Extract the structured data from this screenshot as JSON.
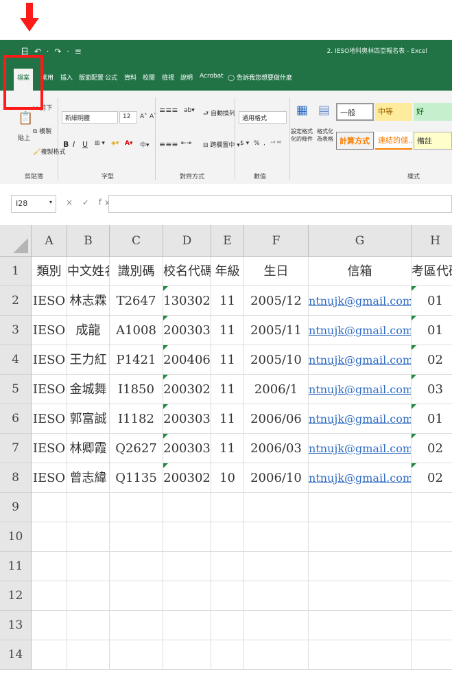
{
  "window": {
    "quick_access": "日 ↶ · ↷ · ≡",
    "title": "2. IESO地科奧林匹亞報名表 - Excel"
  },
  "tabs": [
    "檔案",
    "常用",
    "插入",
    "版面配置",
    "公式",
    "資料",
    "校閱",
    "檢視",
    "說明",
    "Acrobat"
  ],
  "tell_me": "告訴我您想要做什麼",
  "ribbon": {
    "clipboard": {
      "paste": "貼上",
      "cut": "剪下",
      "copy": "複製",
      "format_painter": "複製格式",
      "group": "剪貼簿"
    },
    "font": {
      "name": "新細明體",
      "size": "12",
      "grow": "A˄",
      "shrink": "A˅",
      "bold": "B",
      "italic": "I",
      "underline": "U",
      "group": "字型"
    },
    "alignment": {
      "wrap": "自動換列",
      "merge": "跨欄置中",
      "group": "對齊方式"
    },
    "number": {
      "format": "通用格式",
      "currency": "$",
      "percent": "%",
      "comma": ",",
      "group": "數值"
    },
    "styles": {
      "conditional": "設定格式化的條件",
      "as_table": "格式化為表格",
      "cells": [
        "一般",
        "中等",
        "好",
        "計算方式",
        "連結的儲...",
        "備註"
      ],
      "group": "樣式"
    }
  },
  "formula_bar": {
    "name_box": "I28",
    "icons": "× ✓ fx",
    "content": ""
  },
  "sheet": {
    "columns": [
      "A",
      "B",
      "C",
      "D",
      "E",
      "F",
      "G",
      "H"
    ],
    "row_numbers": [
      "1",
      "2",
      "3",
      "4",
      "5",
      "6",
      "7",
      "8",
      "9",
      "10",
      "11",
      "12",
      "13",
      "14"
    ],
    "header": [
      "類別",
      "中文姓名",
      "識別碼",
      "校名代碼",
      "年級",
      "生日",
      "信箱",
      "考區代碼"
    ],
    "rows": [
      [
        "IESO",
        "林志霖",
        "T2647",
        "130302",
        "11",
        "2005/12",
        "ntnujk@gmail.com",
        "01"
      ],
      [
        "IESO",
        "成龍",
        "A1008",
        "200303",
        "11",
        "2005/11",
        "ntnujk@gmail.com",
        "01"
      ],
      [
        "IESO",
        "王力紅",
        "P1421",
        "200406",
        "11",
        "2005/10",
        "ntnujk@gmail.com",
        "02"
      ],
      [
        "IESO",
        "金城舞",
        "I1850",
        "200302",
        "11",
        "2006/1",
        "ntnujk@gmail.com",
        "03"
      ],
      [
        "IESO",
        "郭富誠",
        "I1182",
        "200303",
        "11",
        "2006/06",
        "ntnujk@gmail.com",
        "01"
      ],
      [
        "IESO",
        "林卿霞",
        "Q2627",
        "200303",
        "11",
        "2006/03",
        "ntnujk@gmail.com",
        "02"
      ],
      [
        "IESO",
        "曾志緯",
        "Q1135",
        "200302",
        "10",
        "2006/10",
        "ntnujk@gmail.com",
        "02"
      ]
    ]
  },
  "colors": {
    "excel_green": "#217346",
    "highlight_red": "#ff1a1a",
    "link_blue": "#2f6cc3"
  }
}
